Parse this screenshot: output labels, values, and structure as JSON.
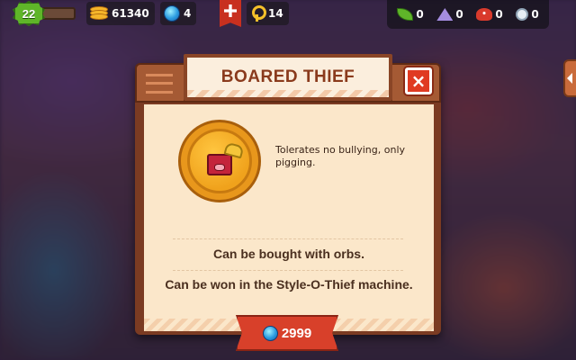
{
  "hud": {
    "level": "22",
    "coins": "61340",
    "orbs": "4",
    "keys": "14",
    "resources": [
      {
        "icon": "leaf-icon",
        "value": "0"
      },
      {
        "icon": "crystal-icon",
        "value": "0"
      },
      {
        "icon": "mushroom-icon",
        "value": "0"
      },
      {
        "icon": "compass-icon",
        "value": "0"
      }
    ]
  },
  "dialog": {
    "title": "BOARED THIEF",
    "close_label": "×",
    "description": "Tolerates no bullying, only pigging.",
    "line1": "Can be bought with orbs.",
    "line2": "Can be won in the Style-O-Thief machine.",
    "price": "2999"
  },
  "colors": {
    "accent_red": "#d8402a",
    "wood": "#a55a34",
    "paper": "#fbe7ca",
    "gold": "#e8971c"
  }
}
